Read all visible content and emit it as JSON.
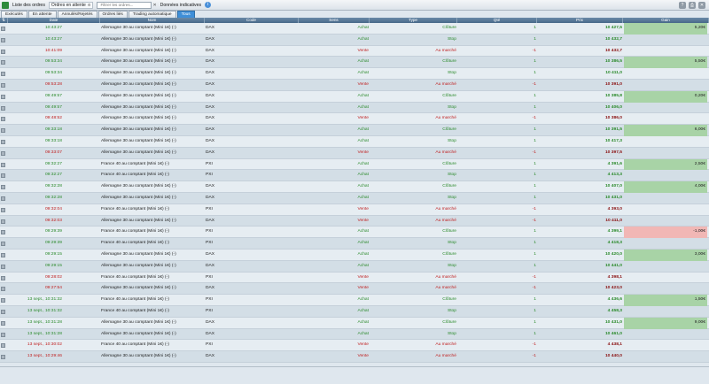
{
  "topbar": {
    "list_label": "Liste des ordres",
    "filter_value": "Ordres en attente",
    "search_placeholder": "Filtrer les ordres...",
    "data_label": "Données indicatives"
  },
  "tabs": [
    "Exécutés",
    "En attente",
    "Annulés/Rejetés",
    "Ordres liés",
    "Trading automatique",
    "Tous"
  ],
  "active_tab": 5,
  "columns": [
    "Date",
    "Nom",
    "Code",
    "Sens",
    "Type",
    "Qté",
    "Prix",
    "Gain"
  ],
  "rows": [
    {
      "date": "10:43:27",
      "nom": "Allemagne 30 au comptant (Mini 1€) (-)",
      "code": "DAX",
      "sens": "Achat",
      "type": "Clôture",
      "qte": "1",
      "prix": "10 427,5",
      "gain": "5,20€",
      "gain_sign": "pos"
    },
    {
      "date": "10:43:27",
      "nom": "Allemagne 30 au comptant (Mini 1€) (-)",
      "code": "DAX",
      "sens": "Achat",
      "type": "Stop",
      "qte": "1",
      "prix": "10 432,7",
      "gain": "",
      "gain_sign": ""
    },
    {
      "date": "10:41:09",
      "nom": "Allemagne 30 au comptant (Mini 1€) (-)",
      "code": "DAX",
      "sens": "Vente",
      "type": "Au marché",
      "qte": "-1",
      "prix": "10 432,7",
      "gain": "",
      "gain_sign": ""
    },
    {
      "date": "09:53:34",
      "nom": "Allemagne 30 au comptant (Mini 1€) (-)",
      "code": "DAX",
      "sens": "Achat",
      "type": "Clôture",
      "qte": "1",
      "prix": "10 386,5",
      "gain": "5,50€",
      "gain_sign": "pos"
    },
    {
      "date": "09:53:34",
      "nom": "Allemagne 30 au comptant (Mini 1€) (-)",
      "code": "DAX",
      "sens": "Achat",
      "type": "Stop",
      "qte": "1",
      "prix": "10 411,0",
      "gain": "",
      "gain_sign": ""
    },
    {
      "date": "09:53:28",
      "nom": "Allemagne 30 au comptant (Mini 1€) (-)",
      "code": "DAX",
      "sens": "Vente",
      "type": "Au marché",
      "qte": "-1",
      "prix": "10 391,0",
      "gain": "",
      "gain_sign": ""
    },
    {
      "date": "09:49:57",
      "nom": "Allemagne 30 au comptant (Mini 1€) (-)",
      "code": "DAX",
      "sens": "Achat",
      "type": "Clôture",
      "qte": "1",
      "prix": "10 385,8",
      "gain": "0,20€",
      "gain_sign": "pos"
    },
    {
      "date": "09:49:57",
      "nom": "Allemagne 30 au comptant (Mini 1€) (-)",
      "code": "DAX",
      "sens": "Achat",
      "type": "Stop",
      "qte": "1",
      "prix": "10 406,0",
      "gain": "",
      "gain_sign": ""
    },
    {
      "date": "09:48:52",
      "nom": "Allemagne 30 au comptant (Mini 1€) (-)",
      "code": "DAX",
      "sens": "Vente",
      "type": "Au marché",
      "qte": "-1",
      "prix": "10 386,0",
      "gain": "",
      "gain_sign": ""
    },
    {
      "date": "09:33:18",
      "nom": "Allemagne 30 au comptant (Mini 1€) (-)",
      "code": "DAX",
      "sens": "Achat",
      "type": "Clôture",
      "qte": "1",
      "prix": "10 391,5",
      "gain": "6,00€",
      "gain_sign": "pos"
    },
    {
      "date": "09:33:18",
      "nom": "Allemagne 30 au comptant (Mini 1€) (-)",
      "code": "DAX",
      "sens": "Achat",
      "type": "Stop",
      "qte": "1",
      "prix": "10 417,3",
      "gain": "",
      "gain_sign": ""
    },
    {
      "date": "09:33:07",
      "nom": "Allemagne 30 au comptant (Mini 1€) (-)",
      "code": "DAX",
      "sens": "Vente",
      "type": "Au marché",
      "qte": "-1",
      "prix": "10 397,5",
      "gain": "",
      "gain_sign": ""
    },
    {
      "date": "09:32:27",
      "nom": "France 40 au comptant (Mini 1€) (-)",
      "code": "PXI",
      "sens": "Achat",
      "type": "Clôture",
      "qte": "1",
      "prix": "4 391,6",
      "gain": "2,50€",
      "gain_sign": "pos"
    },
    {
      "date": "09:32:27",
      "nom": "France 40 au comptant (Mini 1€) (-)",
      "code": "PXI",
      "sens": "Achat",
      "type": "Stop",
      "qte": "1",
      "prix": "4 413,3",
      "gain": "",
      "gain_sign": ""
    },
    {
      "date": "09:32:28",
      "nom": "Allemagne 30 au comptant (Mini 1€) (-)",
      "code": "DAX",
      "sens": "Achat",
      "type": "Clôture",
      "qte": "1",
      "prix": "10 407,0",
      "gain": "4,00€",
      "gain_sign": "pos"
    },
    {
      "date": "09:32:28",
      "nom": "Allemagne 30 au comptant (Mini 1€) (-)",
      "code": "DAX",
      "sens": "Achat",
      "type": "Stop",
      "qte": "1",
      "prix": "10 431,0",
      "gain": "",
      "gain_sign": ""
    },
    {
      "date": "09:32:04",
      "nom": "France 40 au comptant (Mini 1€) (-)",
      "code": "PXI",
      "sens": "Vente",
      "type": "Au marché",
      "qte": "-1",
      "prix": "4 393,0",
      "gain": "",
      "gain_sign": ""
    },
    {
      "date": "09:32:03",
      "nom": "Allemagne 30 au comptant (Mini 1€) (-)",
      "code": "DAX",
      "sens": "Vente",
      "type": "Au marché",
      "qte": "-1",
      "prix": "10 411,0",
      "gain": "",
      "gain_sign": ""
    },
    {
      "date": "09:29:39",
      "nom": "France 40 au comptant (Mini 1€) (-)",
      "code": "PXI",
      "sens": "Achat",
      "type": "Clôture",
      "qte": "1",
      "prix": "4 399,1",
      "gain": "-1,00€",
      "gain_sign": "neg"
    },
    {
      "date": "09:29:39",
      "nom": "France 40 au comptant (Mini 1€) (-)",
      "code": "PXI",
      "sens": "Achat",
      "type": "Stop",
      "qte": "1",
      "prix": "4 418,3",
      "gain": "",
      "gain_sign": ""
    },
    {
      "date": "09:29:15",
      "nom": "Allemagne 30 au comptant (Mini 1€) (-)",
      "code": "DAX",
      "sens": "Achat",
      "type": "Clôture",
      "qte": "1",
      "prix": "10 420,0",
      "gain": "3,00€",
      "gain_sign": "pos"
    },
    {
      "date": "09:29:15",
      "nom": "Allemagne 30 au comptant (Mini 1€) (-)",
      "code": "DAX",
      "sens": "Achat",
      "type": "Stop",
      "qte": "1",
      "prix": "10 441,0",
      "gain": "",
      "gain_sign": ""
    },
    {
      "date": "09:28:02",
      "nom": "France 40 au comptant (Mini 1€) (-)",
      "code": "PXI",
      "sens": "Vente",
      "type": "Au marché",
      "qte": "-1",
      "prix": "4 398,1",
      "gain": "",
      "gain_sign": ""
    },
    {
      "date": "09:27:54",
      "nom": "Allemagne 30 au comptant (Mini 1€) (-)",
      "code": "DAX",
      "sens": "Vente",
      "type": "Au marché",
      "qte": "-1",
      "prix": "10 423,0",
      "gain": "",
      "gain_sign": ""
    },
    {
      "date": "13 sept., 10:31:32",
      "nom": "France 40 au comptant (Mini 1€) (-)",
      "code": "PXI",
      "sens": "Achat",
      "type": "Clôture",
      "qte": "1",
      "prix": "4 436,6",
      "gain": "1,50€",
      "gain_sign": "pos"
    },
    {
      "date": "13 sept., 10:31:32",
      "nom": "France 40 au comptant (Mini 1€) (-)",
      "code": "PXI",
      "sens": "Achat",
      "type": "Stop",
      "qte": "1",
      "prix": "4 458,3",
      "gain": "",
      "gain_sign": ""
    },
    {
      "date": "13 sept., 10:31:28",
      "nom": "Allemagne 30 au comptant (Mini 1€) (-)",
      "code": "DAX",
      "sens": "Achat",
      "type": "Clôture",
      "qte": "1",
      "prix": "10 431,0",
      "gain": "9,00€",
      "gain_sign": "pos"
    },
    {
      "date": "13 sept., 10:31:28",
      "nom": "Allemagne 30 au comptant (Mini 1€) (-)",
      "code": "DAX",
      "sens": "Achat",
      "type": "Stop",
      "qte": "1",
      "prix": "10 461,0",
      "gain": "",
      "gain_sign": ""
    },
    {
      "date": "13 sept., 10:30:02",
      "nom": "France 40 au comptant (Mini 1€) (-)",
      "code": "PXI",
      "sens": "Vente",
      "type": "Au marché",
      "qte": "-1",
      "prix": "4 438,1",
      "gain": "",
      "gain_sign": ""
    },
    {
      "date": "13 sept., 10:29:46",
      "nom": "Allemagne 30 au comptant (Mini 1€) (-)",
      "code": "DAX",
      "sens": "Vente",
      "type": "Au marché",
      "qte": "-1",
      "prix": "10 440,0",
      "gain": "",
      "gain_sign": ""
    }
  ]
}
